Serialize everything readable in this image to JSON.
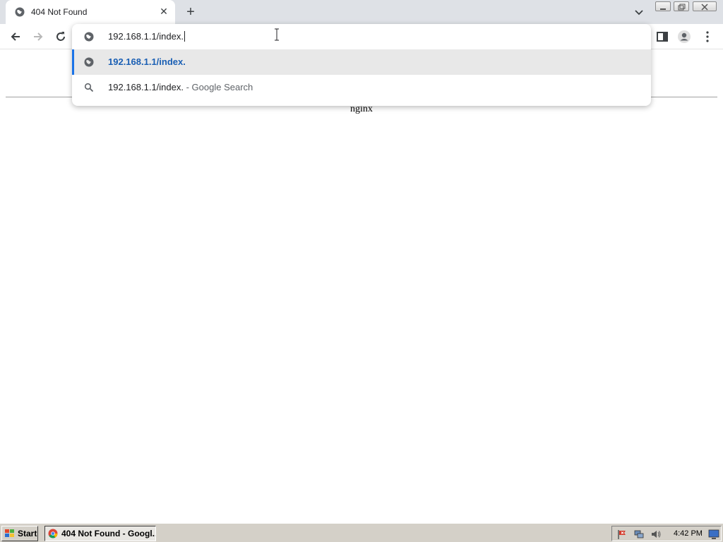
{
  "tab": {
    "title": "404 Not Found",
    "close_icon": "close-icon",
    "new_tab_icon": "plus-icon"
  },
  "omnibox": {
    "typed_text": "192.168.1.1/index.",
    "suggestions": [
      {
        "text": "192.168.1.1/index.",
        "icon": "globe-icon"
      },
      {
        "text": "192.168.1.1/index.",
        "suffix": " - Google Search",
        "icon": "search-icon"
      }
    ]
  },
  "page": {
    "server_name": "nginx"
  },
  "taskbar": {
    "start_label": "Start",
    "task_label": "404 Not Found - Googl...",
    "clock": "4:42 PM"
  },
  "colors": {
    "accent": "#1a73e8",
    "suggestion_highlight": "#e8e8e8",
    "tabstrip": "#dee1e6",
    "taskbar": "#d4d0c8"
  }
}
